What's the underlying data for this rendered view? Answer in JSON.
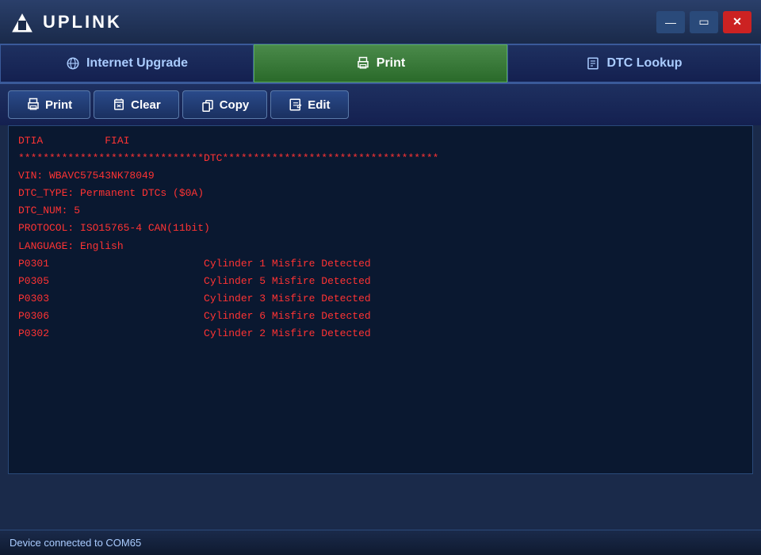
{
  "app": {
    "title": "UPLINK",
    "logo_shape": "triangle"
  },
  "titlebar": {
    "minimize_label": "—",
    "maximize_label": "▭",
    "close_label": "✕"
  },
  "tabs": [
    {
      "id": "internet-upgrade",
      "label": "Internet Upgrade",
      "active": false
    },
    {
      "id": "print",
      "label": "Print",
      "active": true
    },
    {
      "id": "dtc-lookup",
      "label": "DTC Lookup",
      "active": false
    }
  ],
  "toolbar": {
    "print_label": "Print",
    "clear_label": "Clear",
    "copy_label": "Copy",
    "edit_label": "Edit"
  },
  "content": {
    "lines": [
      "DTIA          FIAI",
      "",
      "******************************DTC***********************************",
      "VIN: WBAVC57543NK78049",
      "DTC_TYPE: Permanent DTCs ($0A)",
      "DTC_NUM: 5",
      "PROTOCOL: ISO15765-4 CAN(11bit)",
      "LANGUAGE: English",
      "",
      "P0301                         Cylinder 1 Misfire Detected",
      "",
      "P0305                         Cylinder 5 Misfire Detected",
      "",
      "P0303                         Cylinder 3 Misfire Detected",
      "",
      "P0306                         Cylinder 6 Misfire Detected",
      "",
      "P0302                         Cylinder 2 Misfire Detected"
    ]
  },
  "statusbar": {
    "text": "Device connected to COM65"
  }
}
